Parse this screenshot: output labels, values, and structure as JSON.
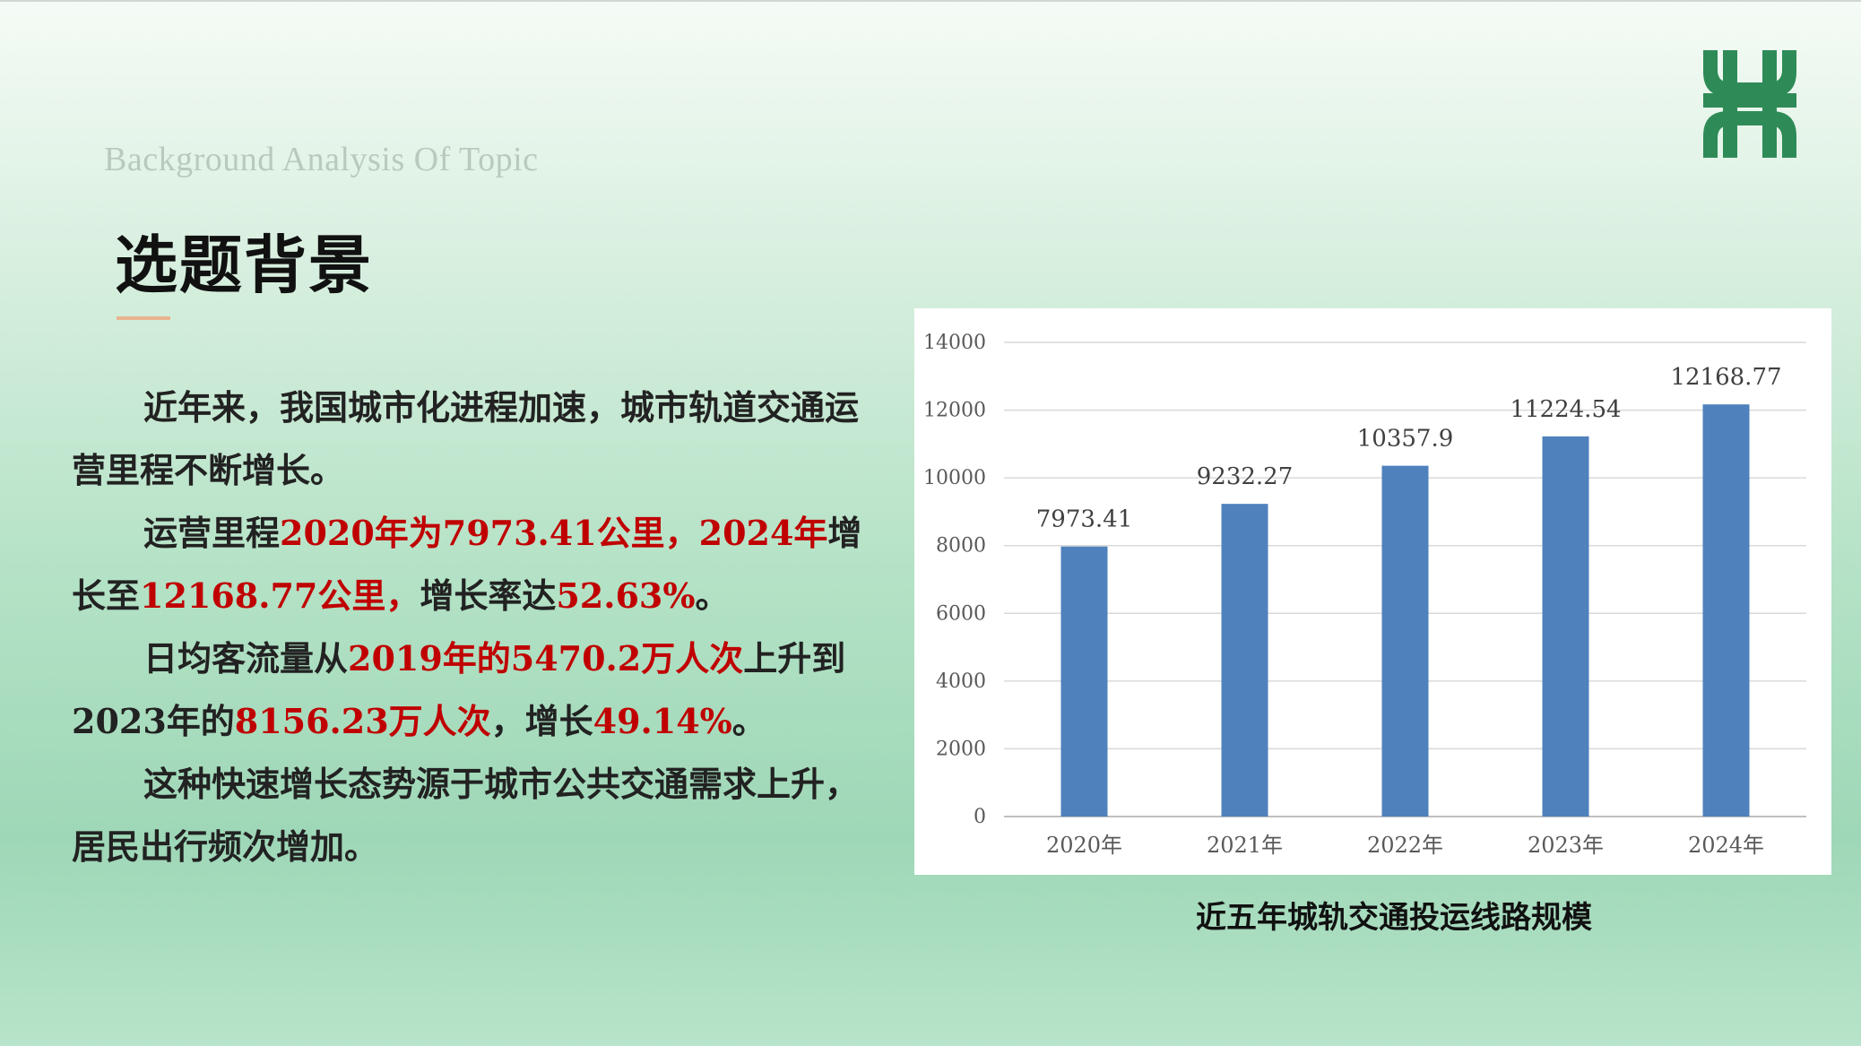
{
  "header": {
    "subtitle": "Background Analysis Of Topic",
    "title": "选题背景",
    "accent_color": "#e9b48f",
    "logo_color": "#2e8b57",
    "logo_icon": "metro-logo-icon"
  },
  "body": {
    "p1": "近年来，我国城市化进程加速，城市轨道交通运营里程不断增长。",
    "p2": {
      "a": "运营里程",
      "b": "2020年为7973.41公里，2024年",
      "c": "增长至",
      "d": "12168.77公里，",
      "e": "增长率达",
      "f": "52.63%",
      "g": "。"
    },
    "p3": {
      "a": "日均客流量从",
      "b": "2019年的5470.2万人次",
      "c": "上升到2023年的",
      "d": "8156.23万人次",
      "e": "，增长",
      "f": "49.14%",
      "g": "。"
    },
    "p4": "这种快速增长态势源于城市公共交通需求上升，居民出行频次增加。",
    "highlight_color": "#c00000"
  },
  "chart_data": {
    "type": "bar",
    "categories": [
      "2020年",
      "2021年",
      "2022年",
      "2023年",
      "2024年"
    ],
    "values": [
      7973.41,
      9232.27,
      10357.9,
      11224.54,
      12168.77
    ],
    "value_labels": [
      "7973.41",
      "9232.27",
      "10357.9",
      "11224.54",
      "12168.77"
    ],
    "ylim": [
      0,
      14000
    ],
    "yticks": [
      0,
      2000,
      4000,
      6000,
      8000,
      10000,
      12000,
      14000
    ],
    "grid": true,
    "bar_color": "#4f81bd",
    "caption": "近五年城轨交通投运线路规模"
  }
}
